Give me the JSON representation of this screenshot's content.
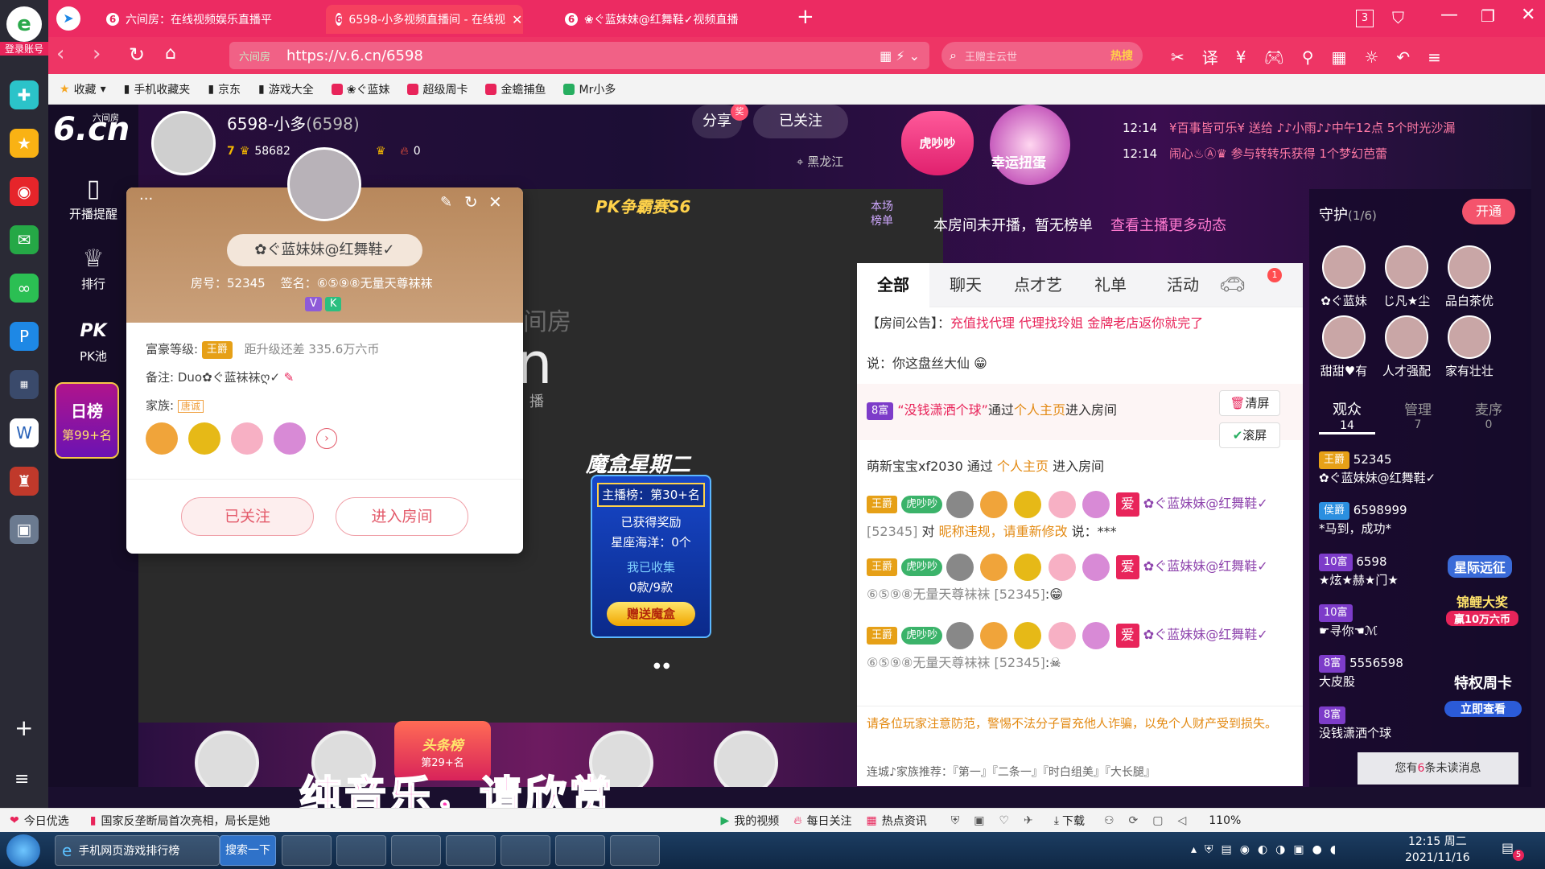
{
  "browser": {
    "left_label": "登录账号",
    "tabs": [
      {
        "title": "六间房：在线视频娱乐直播平",
        "icon": "6"
      },
      {
        "title": "6598-小多视频直播间 - 在线视",
        "icon": "6",
        "active": true
      },
      {
        "title": "❀ぐ蓝妹妹@红舞鞋✓视频直播",
        "icon": "6"
      }
    ],
    "new_tab": "+",
    "window_count": "3",
    "url_prefix": "六间房",
    "url": "https://v.6.cn/6598",
    "search_placeholder": "王赠主云世",
    "search_hot": "热搜",
    "bookmarks": [
      "收藏",
      "手机收藏夹",
      "京东",
      "游戏大全",
      "❀ぐ蓝妹",
      "超级周卡",
      "金蟾捕鱼",
      "Mr小多"
    ]
  },
  "site": {
    "logo_text": "6.cn",
    "logo_sub": "六间房",
    "nav": [
      {
        "label": "开播提醒",
        "icon": "phone-icon"
      },
      {
        "label": "排行",
        "icon": "crown-icon"
      },
      {
        "label": "PK池",
        "icon": "pk-icon"
      }
    ],
    "rank_badge": "日榜",
    "rank_value": "第99+名"
  },
  "anchor": {
    "name": "6598-小多",
    "room_id": "(6598)",
    "level": "7",
    "fans_partial": "58682",
    "heat": "0",
    "share": "分享",
    "share_badge": "奖",
    "followed": "已关注",
    "location": "黑龙江"
  },
  "promo": {
    "tag": "虎吵吵",
    "egg": "幸运扭蛋",
    "ticker": [
      {
        "time": "12:14",
        "text": "¥百事皆可乐¥ 送给 ♪♪小雨♪♪中午12点 5个时光沙漏"
      },
      {
        "time": "12:14",
        "text": "闹心♨Ⓐ♛ 参与转转乐获得 1个梦幻芭蕾"
      }
    ]
  },
  "stage": {
    "pk_banner": "PK争霸赛S6",
    "mohe_title": "魔盒星期二",
    "mohe_rank": "主播榜：第30+名",
    "mohe_reward": "已获得奖励",
    "mohe_star": "星座海洋：0个",
    "mohe_collect": "我已收集",
    "mohe_count": "0款/9款",
    "mohe_btn": "赠送魔盒",
    "video_watermark_a": "间房",
    "video_watermark_b": "n",
    "video_watermark_c": "播",
    "subtitle": "纯音乐，请欣赏",
    "headline_rank": "头条榜",
    "headline_value": "第29+名"
  },
  "card": {
    "more": "···",
    "nickname": "✿ぐ蓝妹妹@红舞鞋✓",
    "room_label": "房号：52345",
    "sign_label": "签名：⑥⑤⑨⑧无量天尊袜袜",
    "badges": [
      "V",
      "K"
    ],
    "wealth_label": "富豪等级:",
    "wealth_rank": "王爵",
    "upgrade": "距升级还差 335.6万六币",
    "note_label": "备注:",
    "note_value": "Duo✿ぐ蓝袜袜ღ✓",
    "family_label": "家族:",
    "family_value": "唐诚",
    "follow_btn": "已关注",
    "enter_btn": "进入房间"
  },
  "board": {
    "label1": "本场",
    "label2": "榜单",
    "text": "本房间未开播，暂无榜单",
    "link": "查看主播更多动态"
  },
  "chat": {
    "tabs": [
      "全部",
      "聊天",
      "点才艺",
      "礼单",
      "活动"
    ],
    "car_badge": "1",
    "notice_label": "【房间公告】：",
    "notice": "充值找代理 代理找玲姐 金牌老店返你就完了",
    "line0": "说：你这盘丝大仙",
    "l1_level": "8富",
    "l1_name": "“没钱潇洒个球”",
    "l1_via": "通过",
    "l1_link": "个人主页",
    "l1_tail": "进入房间",
    "clear": "清屏",
    "scroll": "滚屏",
    "l2_name": "萌新宝宝xf2030",
    "l2_via": " 通过 ",
    "l2_link": "个人主页",
    "l2_tail": " 进入房间",
    "l3_rank": "王爵",
    "l3_tag": "虎吵吵",
    "l3_ai": "爱",
    "l3_name": "✿ぐ蓝妹妹@红舞鞋✓",
    "l3_id": "[52345]",
    "l3_text": " 对 ",
    "l3_target": "昵称违规，请重新修改",
    "l3_say": " 说：***",
    "l4_name": "✿ぐ蓝妹妹@红舞鞋✓",
    "l4_sign": "⑥⑤⑨⑧无量天尊袜袜",
    "l4_id": "[52345]",
    "l5_name": "✿ぐ蓝妹妹@红舞鞋✓",
    "l5_sign": "⑥⑤⑨⑧无量天尊袜袜",
    "l5_id": "[52345]",
    "warning": "请各位玩家注意防范，警惕不法分子冒充他人诈骗，以免个人财产受到损失。",
    "recommend": "连城♪家族推荐：『第一』『二条一』『时白组美』『大长腿』"
  },
  "guard": {
    "title": "守护",
    "count": "(1/6)",
    "open": "开通",
    "members": [
      "✿ぐ蓝妹",
      "じ凡★尘",
      "品白茶优",
      "甜甜♥有",
      "人才强配",
      "家有壮壮"
    ],
    "tabs": [
      {
        "label": "观众",
        "count": "14"
      },
      {
        "label": "管理",
        "count": "7"
      },
      {
        "label": "麦序",
        "count": "0"
      }
    ],
    "audience": [
      {
        "rank": "王爵",
        "id": "52345",
        "name": "✿ぐ蓝妹妹@红舞鞋✓"
      },
      {
        "rank": "侯爵",
        "id": "6598999",
        "name": "*马到，成功*"
      },
      {
        "rank": "10富",
        "id": "6598",
        "name": "★炫★赫★门★"
      },
      {
        "rank": "10富",
        "id": "",
        "name": "☛寻你☚ℳ"
      },
      {
        "rank": "8富",
        "id": "5556598",
        "name": "大皮股"
      },
      {
        "rank": "8富",
        "id": "",
        "name": "没钱潇洒个球"
      }
    ],
    "promo1": "星际远征",
    "promo2": "锦鲤大奖",
    "promo2_sub": "赢10万六币",
    "promo3": "特权周卡",
    "promo3_btn": "立即查看",
    "unread_prefix": "您有",
    "unread_count": "6",
    "unread_suffix": "条未读消息"
  },
  "statusbar": {
    "left1": "今日优选",
    "left2": "国家反垄断局首次亮相，局长是她",
    "items": [
      "我的视频",
      "每日关注",
      "热点资讯"
    ],
    "download": "下载",
    "zoom": "110%"
  },
  "taskbar": {
    "app1": "手机网页游戏排行榜",
    "search": "搜索一下",
    "time": "12:15 周二",
    "date": "2021/11/16",
    "notif": "5"
  },
  "colors": {
    "accent": "#e8245a",
    "tabbar": "#ec2b62",
    "gold": "#e6a017"
  }
}
